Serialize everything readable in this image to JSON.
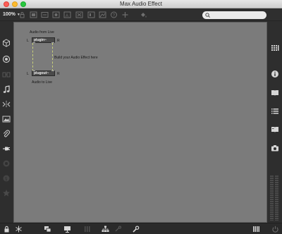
{
  "window": {
    "title": "Max Audio Effect"
  },
  "toolbar": {
    "zoom_level": "100%",
    "icons": [
      "lock-icon",
      "unlock-icon",
      "new-object-icon",
      "new-message-icon",
      "new-comment-icon",
      "presentation-icon",
      "hint-icon",
      "add-icon",
      "paint-icon"
    ]
  },
  "search": {
    "placeholder": ""
  },
  "sidebar_left": {
    "icons": [
      "cube-icon",
      "target-icon",
      "link-icon",
      "music-note-icon",
      "split-icon",
      "image-icon",
      "paperclip-icon",
      "plug-icon",
      "circle-icon",
      "snippet-icon",
      "star-icon"
    ]
  },
  "sidebar_right": {
    "icons": [
      "grid-icon",
      "info-icon",
      "book-icon",
      "list-icon",
      "reference-icon",
      "camera-icon"
    ]
  },
  "patch": {
    "comment_top": "Audio from Live",
    "comment_mid": "Build your Audio Effect here",
    "comment_bottom": "Audio to Live",
    "in_object": "plugin~",
    "out_object": "plugout~",
    "left_label": "L",
    "right_label": "R"
  },
  "bottombar": {
    "icons": [
      "lock-icon",
      "snowflake-icon",
      "windows-icon",
      "presentation-icon",
      "grid-icon",
      "hierarchy-icon",
      "debug-icon",
      "wrench-icon",
      "meter-icon",
      "power-icon"
    ]
  }
}
